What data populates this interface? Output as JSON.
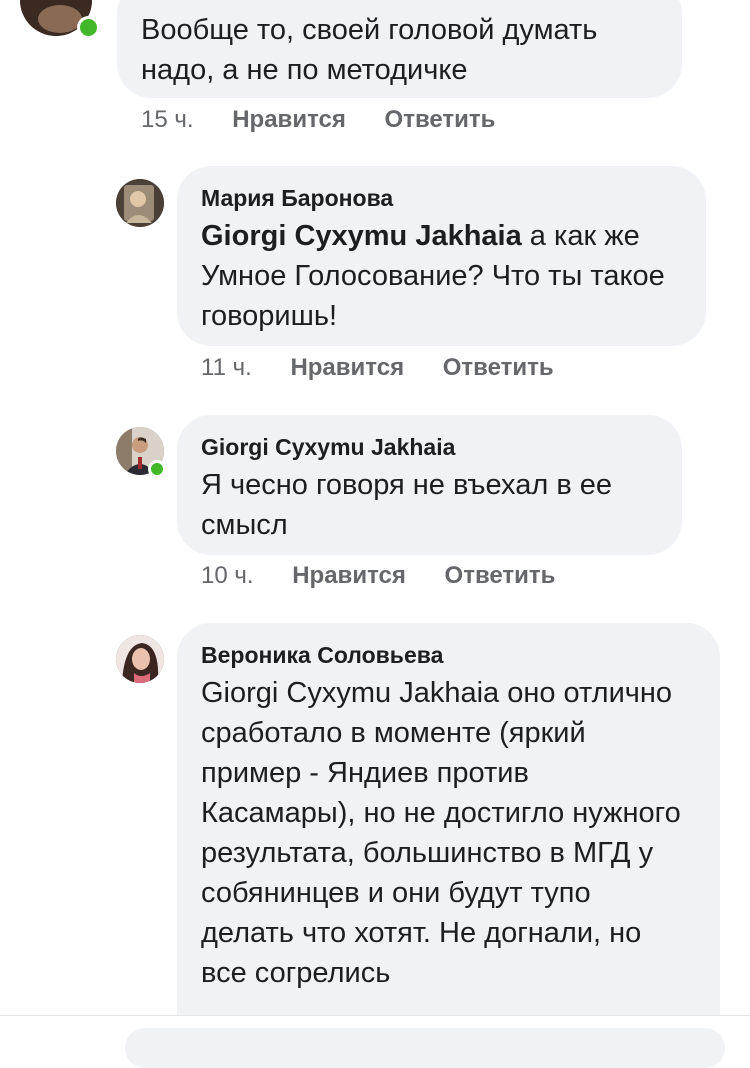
{
  "comments": [
    {
      "author": "",
      "text": "Вообще то, своей головой думать надо, а не по методичке",
      "time": "15 ч.",
      "like": "Нравится",
      "reply": "Ответить"
    },
    {
      "author": "Мария Баронова",
      "mention": "Giorgi Cyxymu Jakhaia",
      "text_after_mention": " а как же Умное Голосование? Что ты такое говоришь!",
      "time": "11 ч.",
      "like": "Нравится",
      "reply": "Ответить"
    },
    {
      "author": "Giorgi Cyxymu Jakhaia",
      "text": "Я чесно говоря не въехал в ее смысл",
      "time": "10 ч.",
      "like": "Нравится",
      "reply": "Ответить"
    },
    {
      "author": "Вероника Соловьева",
      "text": "Giorgi Cyxymu Jakhaia оно отлично сработало в моменте (яркий пример - Яндиев против Касамары), но не достигло нужного результата, большинство в МГД у собянинцев и они будут тупо делать что хотят. Не догнали, но все согрелись"
    }
  ],
  "colors": {
    "bubble": "#f0f2f5",
    "text": "#1c1e21",
    "meta": "#65676b",
    "online": "#42b72a"
  }
}
